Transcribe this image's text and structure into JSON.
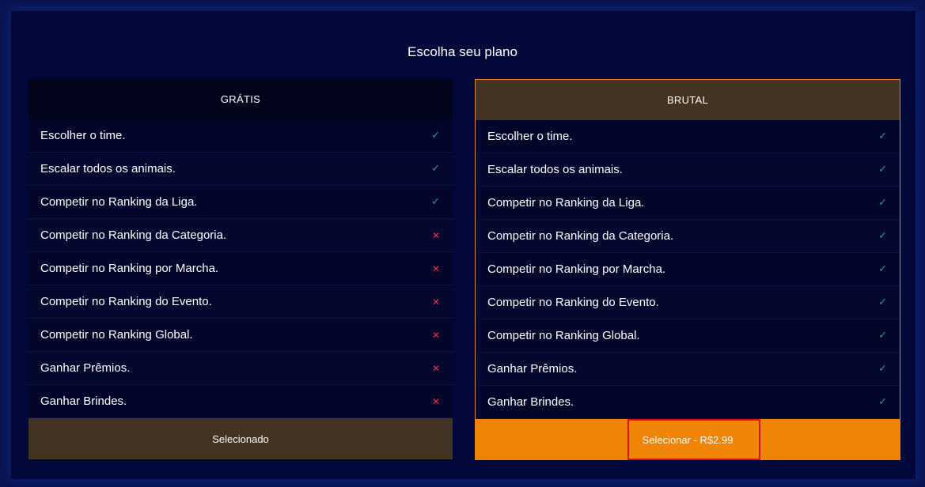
{
  "page_title": "Escolha seu plano",
  "plans": [
    {
      "name": "GRÁTIS",
      "features": [
        {
          "label": "Escolher o time.",
          "included": true
        },
        {
          "label": "Escalar todos os animais.",
          "included": true
        },
        {
          "label": "Competir no Ranking da Liga.",
          "included": true
        },
        {
          "label": "Competir no Ranking da Categoria.",
          "included": false
        },
        {
          "label": "Competir no Ranking por Marcha.",
          "included": false
        },
        {
          "label": "Competir no Ranking do Evento.",
          "included": false
        },
        {
          "label": "Competir no Ranking Global.",
          "included": false
        },
        {
          "label": "Ganhar Prêmios.",
          "included": false
        },
        {
          "label": "Ganhar Brindes.",
          "included": false
        }
      ],
      "action_label": "Selecionado"
    },
    {
      "name": "BRUTAL",
      "features": [
        {
          "label": "Escolher o time.",
          "included": true
        },
        {
          "label": "Escalar todos os animais.",
          "included": true
        },
        {
          "label": "Competir no Ranking da Liga.",
          "included": true
        },
        {
          "label": "Competir no Ranking da Categoria.",
          "included": true
        },
        {
          "label": "Competir no Ranking por Marcha.",
          "included": true
        },
        {
          "label": "Competir no Ranking do Evento.",
          "included": true
        },
        {
          "label": "Competir no Ranking Global.",
          "included": true
        },
        {
          "label": "Ganhar Prêmios.",
          "included": true
        },
        {
          "label": "Ganhar Brindes.",
          "included": true
        }
      ],
      "action_label": "Selecionar - R$2.99"
    }
  ],
  "icons": {
    "included": "check-icon",
    "excluded": "close-icon"
  },
  "colors": {
    "background": "#03083a",
    "accent_orange": "#ef8407",
    "header_brown": "#433323",
    "check_green": "#2a9d82",
    "cross_red": "#e0334b"
  }
}
